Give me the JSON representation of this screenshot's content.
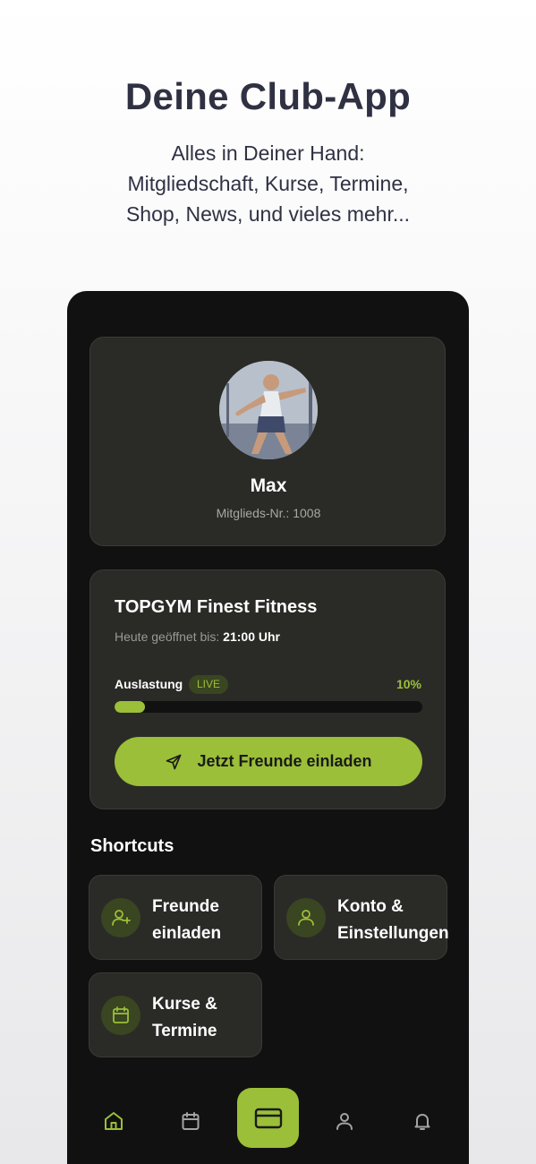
{
  "hero": {
    "title": "Deine Club-App",
    "subtitle_lines": [
      "Alles in Deiner Hand:",
      "Mitgliedschaft, Kurse, Termine,",
      "Shop, News, und vieles mehr..."
    ]
  },
  "profile": {
    "name": "Max",
    "member_number": "Mitglieds-Nr.: 1008"
  },
  "gym": {
    "name": "TOPGYM Finest Fitness",
    "hours_label": "Heute geöffnet bis:",
    "hours_value": "21:00 Uhr",
    "load_label": "Auslastung",
    "live_badge": "LIVE",
    "load_percent_text": "10%",
    "load_fraction": 0.1,
    "invite_button": "Jetzt Freunde einladen"
  },
  "shortcuts": {
    "title": "Shortcuts",
    "items": [
      {
        "line1": "Freunde",
        "line2": "einladen",
        "icon": "user-plus-icon"
      },
      {
        "line1": "Konto &",
        "line2": "Einstellungen",
        "icon": "user-icon"
      },
      {
        "line1": "Kurse &",
        "line2": "Termine",
        "icon": "calendar-icon"
      }
    ]
  },
  "bottom_nav": {
    "items": [
      "home-icon",
      "calendar-icon",
      "card-icon",
      "profile-icon",
      "bell-icon"
    ],
    "active": "home-icon"
  },
  "colors": {
    "accent": "#9bbf38",
    "phone_bg": "#111111",
    "card_bg": "#2a2b27",
    "heading": "#2f3143"
  }
}
